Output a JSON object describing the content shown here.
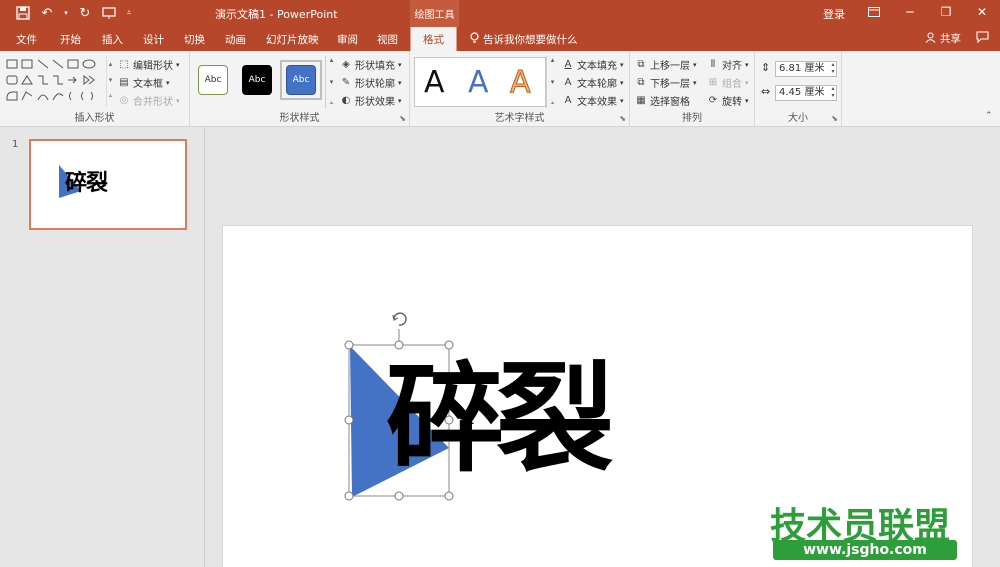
{
  "titlebar": {
    "doc_title": "演示文稿1 - PowerPoint",
    "context_group": "绘图工具",
    "login": "登录"
  },
  "tabs": [
    {
      "label": "文件"
    },
    {
      "label": "开始"
    },
    {
      "label": "插入"
    },
    {
      "label": "设计"
    },
    {
      "label": "切换"
    },
    {
      "label": "动画"
    },
    {
      "label": "幻灯片放映"
    },
    {
      "label": "审阅"
    },
    {
      "label": "视图"
    },
    {
      "label": "格式"
    }
  ],
  "active_tab": "格式",
  "tell_me": "告诉我你想要做什么",
  "share": "共享",
  "ribbon": {
    "insert_shapes": {
      "label": "插入形状",
      "edit_shape": "编辑形状",
      "text_box": "文本框",
      "merge_shapes": "合并形状"
    },
    "shape_styles": {
      "label": "形状样式",
      "style_samples": [
        "Abc",
        "Abc",
        "Abc"
      ],
      "fill": "形状填充",
      "outline": "形状轮廓",
      "effects": "形状效果"
    },
    "wordart": {
      "label": "艺术字样式",
      "samples": [
        "A",
        "A",
        "A"
      ],
      "text_fill": "文本填充",
      "text_outline": "文本轮廓",
      "text_effects": "文本效果"
    },
    "arrange": {
      "label": "排列",
      "bring_forward": "上移一层",
      "send_backward": "下移一层",
      "selection_pane": "选择窗格",
      "align": "对齐",
      "group": "组合",
      "rotate": "旋转"
    },
    "size": {
      "label": "大小",
      "height": "6.81 厘米",
      "width": "4.45 厘米"
    }
  },
  "thumbnail": {
    "number": "1",
    "text": "碎裂"
  },
  "slide": {
    "text": "碎裂"
  },
  "watermark": {
    "title": "技术员联盟",
    "url": "www.jsgho.com"
  },
  "colors": {
    "accent": "#b7472a",
    "shape_blue": "#4472c4",
    "watermark_green": "#2e9e3a"
  }
}
